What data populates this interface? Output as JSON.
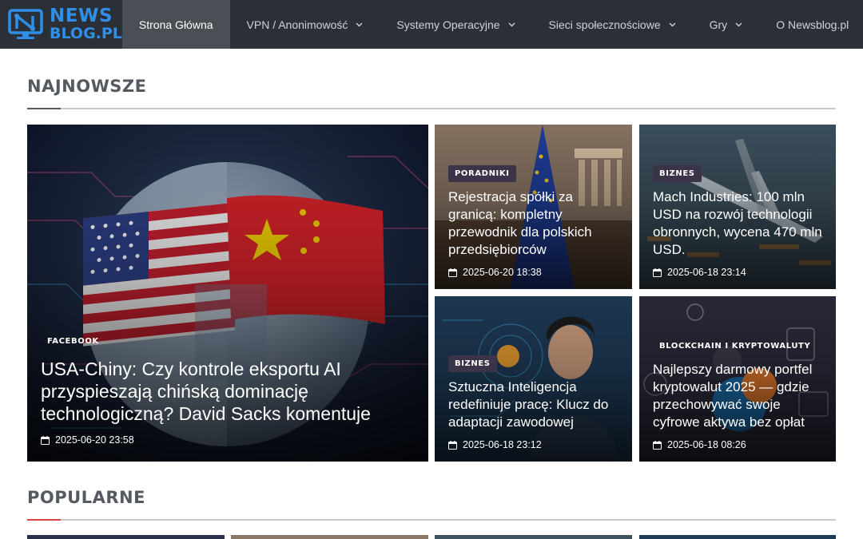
{
  "brand": {
    "line1": "NEWS",
    "line2": "BLOG.PL",
    "color": "#2f8fe8"
  },
  "nav": [
    {
      "label": "Strona Główna",
      "active": true,
      "dropdown": false
    },
    {
      "label": "VPN / Anonimowość",
      "active": false,
      "dropdown": true
    },
    {
      "label": "Systemy Operacyjne",
      "active": false,
      "dropdown": true
    },
    {
      "label": "Sieci społecznościowe",
      "active": false,
      "dropdown": true
    },
    {
      "label": "Gry",
      "active": false,
      "dropdown": true
    },
    {
      "label": "O Newsblog.pl",
      "active": false,
      "dropdown": false
    }
  ],
  "sections": {
    "latest": {
      "title": "NAJNOWSZE",
      "accent": "#555a60"
    },
    "popular": {
      "title": "POPULARNE",
      "accent": "#e0443e"
    }
  },
  "latest_cards": [
    {
      "category": "FACEBOOK",
      "title": "USA-Chiny: Czy kontrole eksportu AI przyspieszają chińską dominację technologiczną? David Sacks komentuje",
      "date": "2025-06-20 23:58"
    },
    {
      "category": "PORADNIKI",
      "title": "Rejestracja spółki za granicą: kompletny przewodnik dla polskich przedsiębiorców",
      "date": "2025-06-20 18:38"
    },
    {
      "category": "BIZNES",
      "title": "Mach Industries: 100 mln USD na rozwój technologii obronnych, wycena 470 mln USD.",
      "date": "2025-06-18 23:14"
    },
    {
      "category": "BIZNES",
      "title": "Sztuczna Inteligencja redefiniuje pracę: Klucz do adaptacji zawodowej",
      "date": "2025-06-18 23:12"
    },
    {
      "category": "BLOCKCHAIN I KRYPTOWALUTY",
      "title": "Najlepszy darmowy portfel kryptowalut 2025 — gdzie przechowywać swoje cyfrowe aktywa bez opłat",
      "date": "2025-06-18 08:26"
    }
  ],
  "icons": {
    "calendar": "calendar-icon",
    "chevron": "chevron-down-icon",
    "logo": "monitor-n-logo-icon"
  }
}
